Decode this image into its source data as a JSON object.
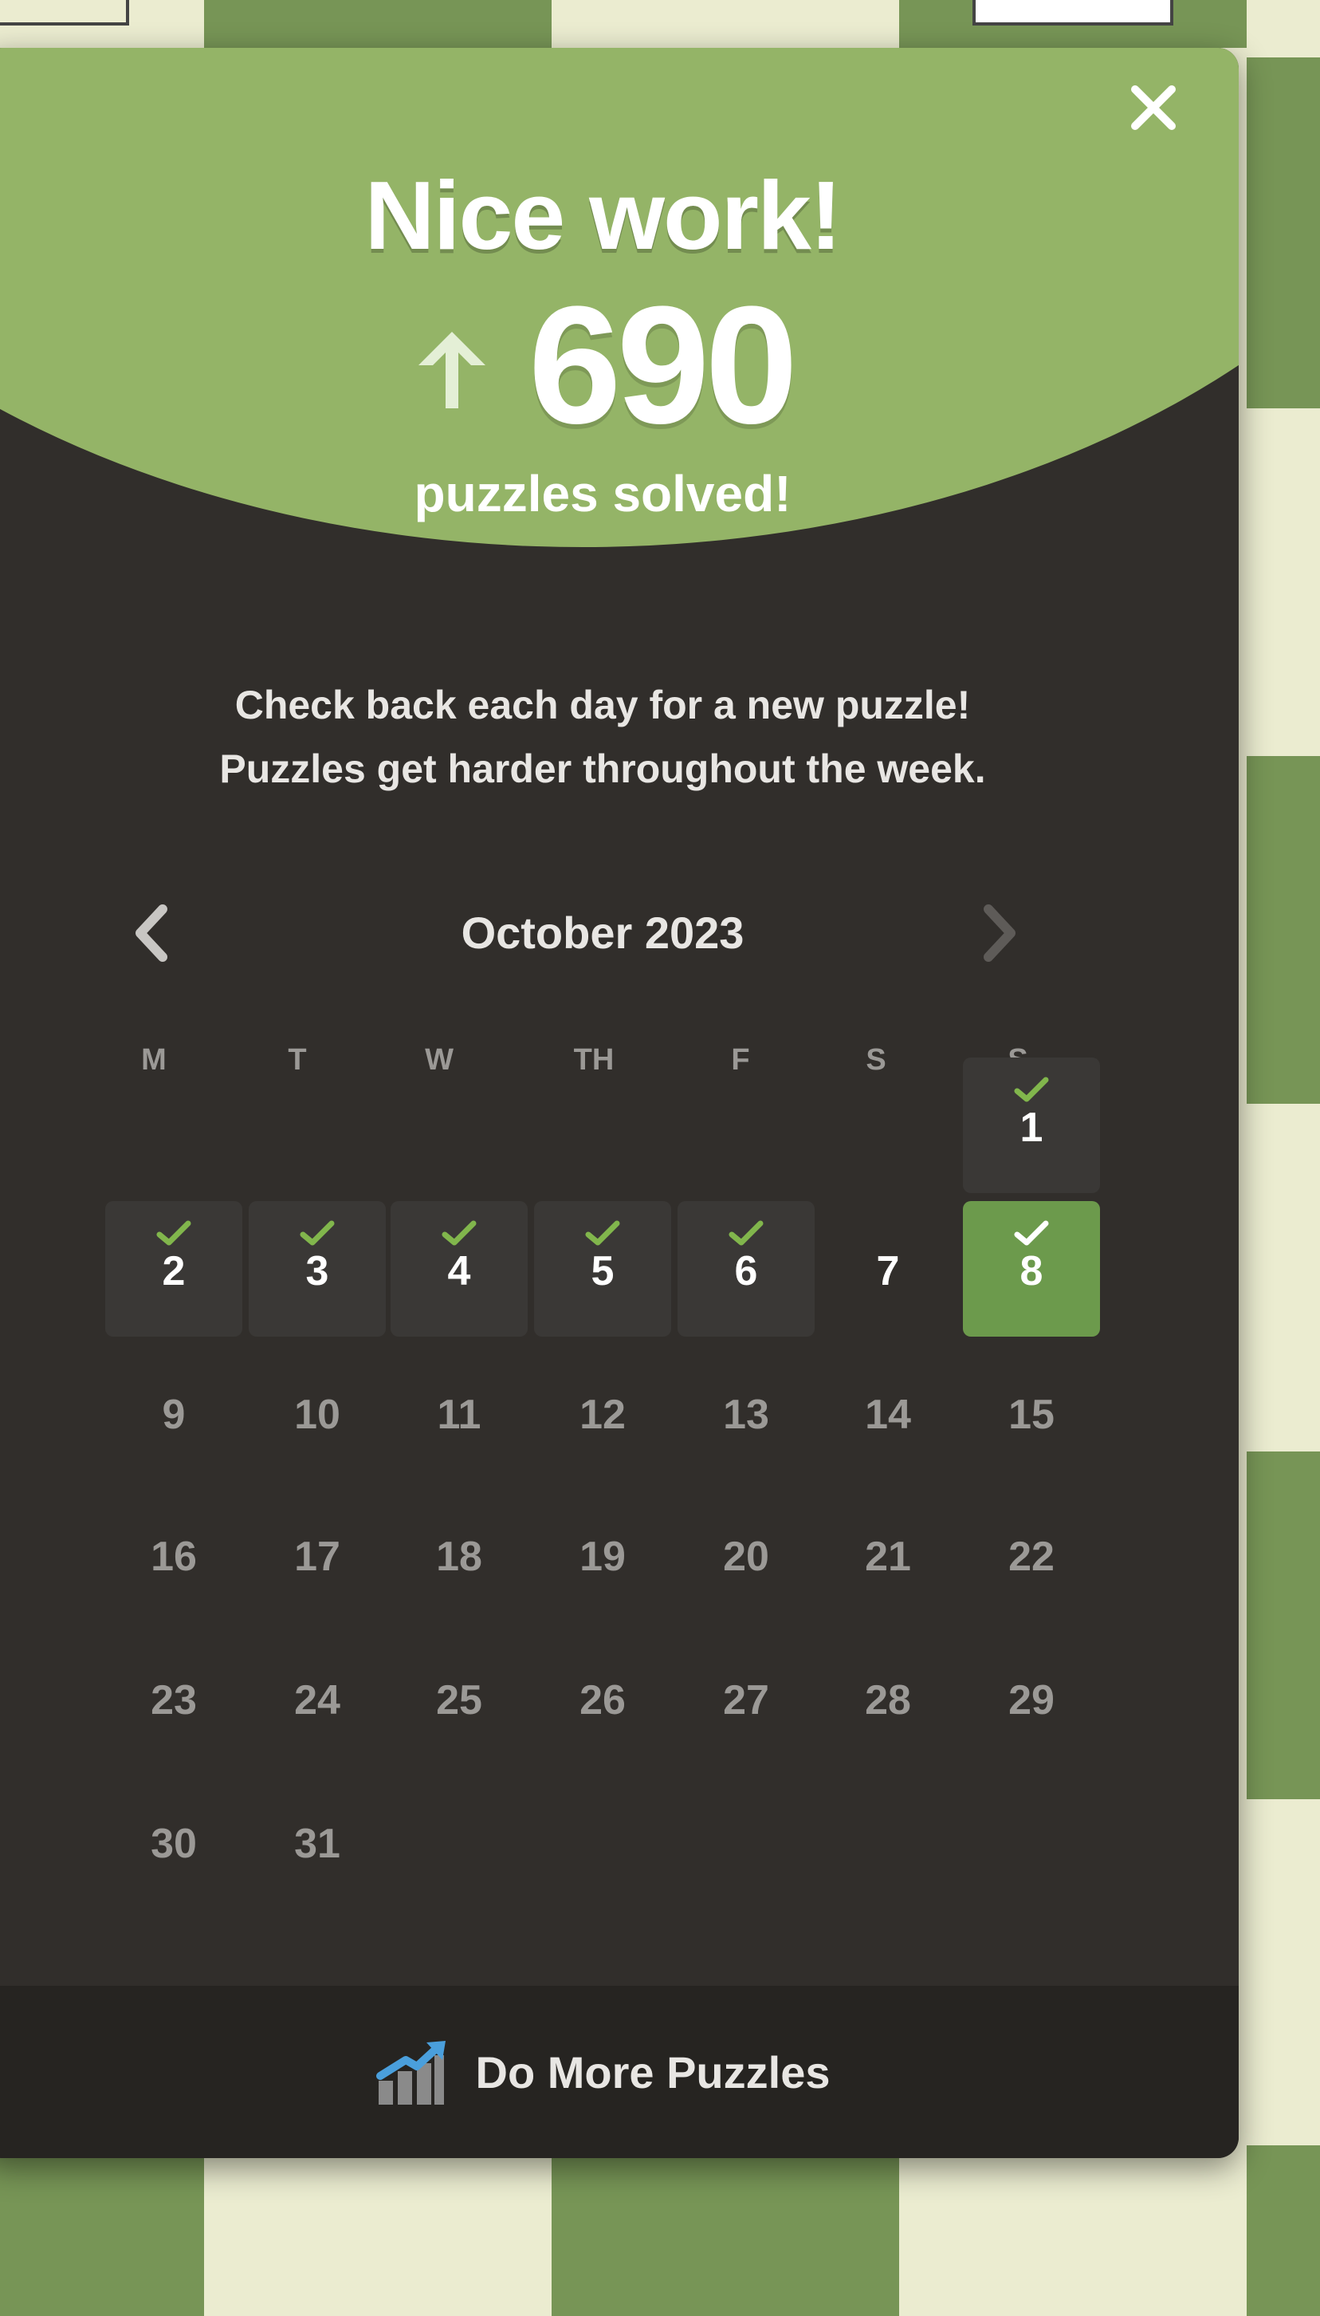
{
  "modal": {
    "title": "Nice work!",
    "solved_count": "690",
    "solved_label": "puzzles solved!",
    "description_line1": "Check back each day for a new puzzle!",
    "description_line2": "Puzzles get harder throughout the week.",
    "close_icon": "close-icon",
    "arrow_icon": "arrow-up-icon"
  },
  "calendar": {
    "month_label": "October 2023",
    "prev_icon": "chevron-left-icon",
    "next_icon": "chevron-right-icon",
    "weekdays": [
      "M",
      "T",
      "W",
      "TH",
      "F",
      "S",
      "S"
    ],
    "day_numbers": [
      "1",
      "2",
      "3",
      "4",
      "5",
      "6",
      "7",
      "8",
      "9",
      "10",
      "11",
      "12",
      "13",
      "14",
      "15",
      "16",
      "17",
      "18",
      "19",
      "20",
      "21",
      "22",
      "23",
      "24",
      "25",
      "26",
      "27",
      "28",
      "29",
      "30",
      "31"
    ],
    "solved_days": [
      "1",
      "2",
      "3",
      "4",
      "5",
      "6",
      "8"
    ],
    "today": "8"
  },
  "footer": {
    "label": "Do More Puzzles",
    "icon": "trend-chart-icon"
  },
  "colors": {
    "green": "#94b467",
    "board_green": "#779556",
    "board_light": "#ebecd0",
    "modal_bg": "#312e2b",
    "footer_bg": "#262421",
    "today_green": "#6c9a4c"
  }
}
